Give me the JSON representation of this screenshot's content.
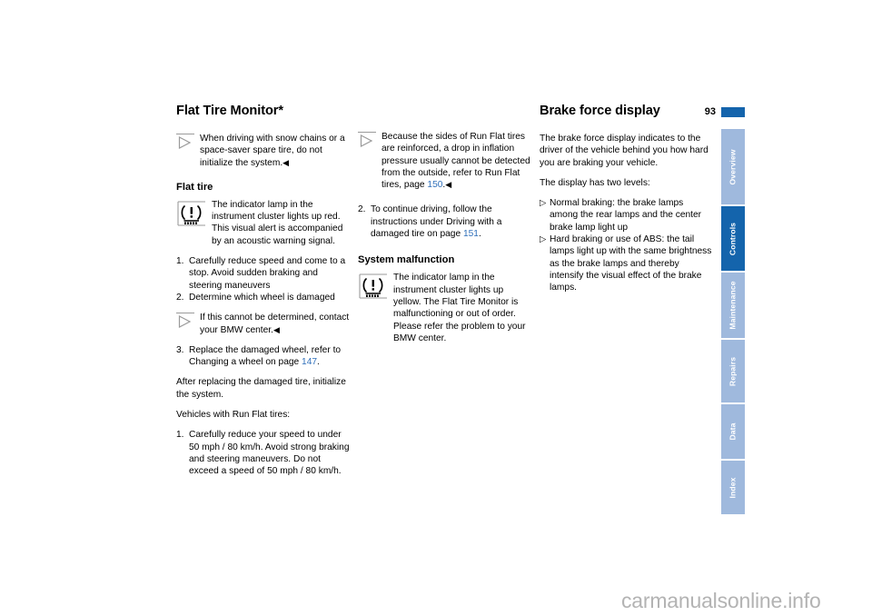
{
  "page": {
    "number": "93",
    "watermark": "carmanualsonline.info"
  },
  "columns": {
    "left": {
      "title": "Flat Tire Monitor*",
      "note1": {
        "icon": "triangle-note-icon",
        "text": "When driving with snow chains or a space-saver spare tire, do not initialize the system.",
        "end_mark": "◀"
      },
      "subtitle_flat_tire": "Flat tire",
      "lamp1": {
        "icon": "tire-pressure-warning-lamp-icon",
        "text": "The indicator lamp in the instrument cluster lights up red. This visual alert is accompanied by an acoustic warning signal."
      },
      "steps_a": [
        {
          "num": "1.",
          "text": "Carefully reduce speed and come to a stop. Avoid sudden braking and steering maneuvers"
        },
        {
          "num": "2.",
          "text": "Determine which wheel is damaged"
        }
      ],
      "note2": {
        "icon": "triangle-note-icon",
        "text": "If this cannot be determined, contact your BMW center.",
        "end_mark": "◀"
      },
      "steps_b": [
        {
          "num": "3.",
          "text_before": "Replace the damaged wheel, refer to Changing a wheel on page ",
          "page_ref": "147",
          "text_after": "."
        }
      ],
      "para_after": "After replacing the damaged tire, initialize the system.",
      "para_runflat": "Vehicles with Run Flat tires:",
      "steps_c": [
        {
          "num": "1.",
          "text": "Carefully reduce your speed to under 50 mph  / 80 km/h. Avoid strong braking and steering maneuvers. Do not exceed a speed of 50 mph / 80 km/h."
        }
      ]
    },
    "middle": {
      "note1": {
        "icon": "triangle-note-icon",
        "text_before": "Because the sides of Run Flat tires are reinforced, a drop in inflation pressure usually cannot be detected from the outside, refer to Run Flat tires, page ",
        "page_ref": "150",
        "text_after": ".",
        "end_mark": "◀"
      },
      "steps": [
        {
          "num": "2.",
          "text_before": "To continue driving, follow the instructions under Driving with a damaged tire on page ",
          "page_ref": "151",
          "text_after": "."
        }
      ],
      "subtitle_malfunction": "System malfunction",
      "lamp1": {
        "icon": "tire-pressure-warning-lamp-icon",
        "text": "The indicator lamp in the instrument cluster lights up yellow. The Flat Tire Monitor is malfunctioning or out of order. Please refer the problem to your BMW center."
      }
    },
    "right": {
      "title": "Brake force display",
      "para1": "The brake force display indicates to the driver of the vehicle behind you how hard you are braking your vehicle.",
      "para2": "The display has two levels:",
      "bullets": [
        {
          "marker": "▷",
          "text": "Normal braking: the brake lamps among the rear lamps and the center brake lamp light up"
        },
        {
          "marker": "▷",
          "text": "Hard braking or use of ABS: the tail lamps light up with the same brightness as the brake lamps and thereby intensify the visual effect of the brake lamps."
        }
      ]
    }
  },
  "tabs": [
    {
      "label": "Overview",
      "active": false
    },
    {
      "label": "Controls",
      "active": true
    },
    {
      "label": "Maintenance",
      "active": false
    },
    {
      "label": "Repairs",
      "active": false
    },
    {
      "label": "Data",
      "active": false
    },
    {
      "label": "Index",
      "active": false
    }
  ],
  "colors": {
    "accent_active": "#1464ac",
    "accent_inactive": "#9fb9dd",
    "page_ref_link": "#2f6fba",
    "watermark": "#b3b3b3"
  }
}
